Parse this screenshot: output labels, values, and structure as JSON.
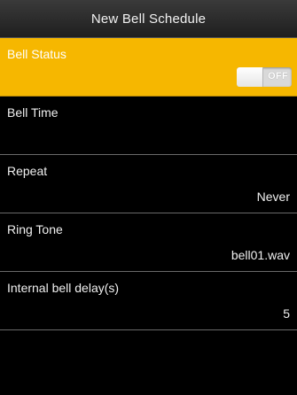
{
  "header": {
    "title": "New Bell Schedule"
  },
  "items": [
    {
      "label": "Bell Status",
      "value": "",
      "selected": true
    },
    {
      "label": "Bell Time",
      "value": ""
    },
    {
      "label": "Repeat",
      "value": "Never"
    },
    {
      "label": "Ring Tone",
      "value": "bell01.wav"
    },
    {
      "label": "Internal bell delay(s)",
      "value": "5"
    }
  ],
  "bell_status_toggle": {
    "state_text": "OFF",
    "on": false
  },
  "colors": {
    "selected_bg": "#f6b700",
    "background": "#000000",
    "divider": "#6a6a6a"
  }
}
